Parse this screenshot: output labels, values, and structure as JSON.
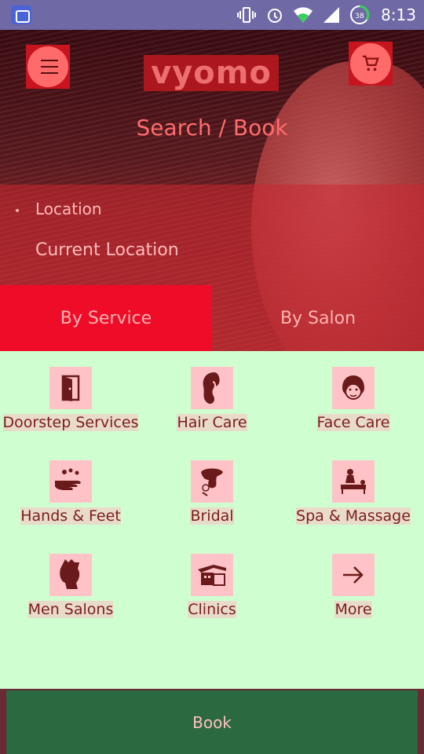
{
  "status_bar": {
    "time": "8:13",
    "battery_level": "38",
    "icons": [
      "app-notification-icon",
      "vibrate-icon",
      "alarm-icon",
      "wifi-icon",
      "cell-signal-icon",
      "battery-icon"
    ]
  },
  "header": {
    "logo_text": "vyomo",
    "title": "Search / Book"
  },
  "location": {
    "label": "Location",
    "value": "Current Location"
  },
  "tabs": [
    {
      "label": "By Service",
      "active": true
    },
    {
      "label": "By Salon",
      "active": false
    }
  ],
  "services": [
    {
      "label": "Doorstep Services",
      "icon": "door-icon"
    },
    {
      "label": "Hair Care",
      "icon": "hair-care-icon"
    },
    {
      "label": "Face Care",
      "icon": "face-care-icon"
    },
    {
      "label": "Hands & Feet",
      "icon": "hands-feet-icon"
    },
    {
      "label": "Bridal",
      "icon": "bridal-icon"
    },
    {
      "label": "Spa & Massage",
      "icon": "spa-massage-icon"
    },
    {
      "label": "Men Salons",
      "icon": "men-salon-icon"
    },
    {
      "label": "Clinics",
      "icon": "clinic-icon"
    },
    {
      "label": "More",
      "icon": "arrow-right-icon"
    }
  ],
  "book_button": {
    "label": "Book"
  },
  "colors": {
    "accent": "#ef0c28",
    "grid_background": "#cfffd0",
    "book_bar": "#2b6940",
    "icon_tile": "#ffc3c7"
  }
}
